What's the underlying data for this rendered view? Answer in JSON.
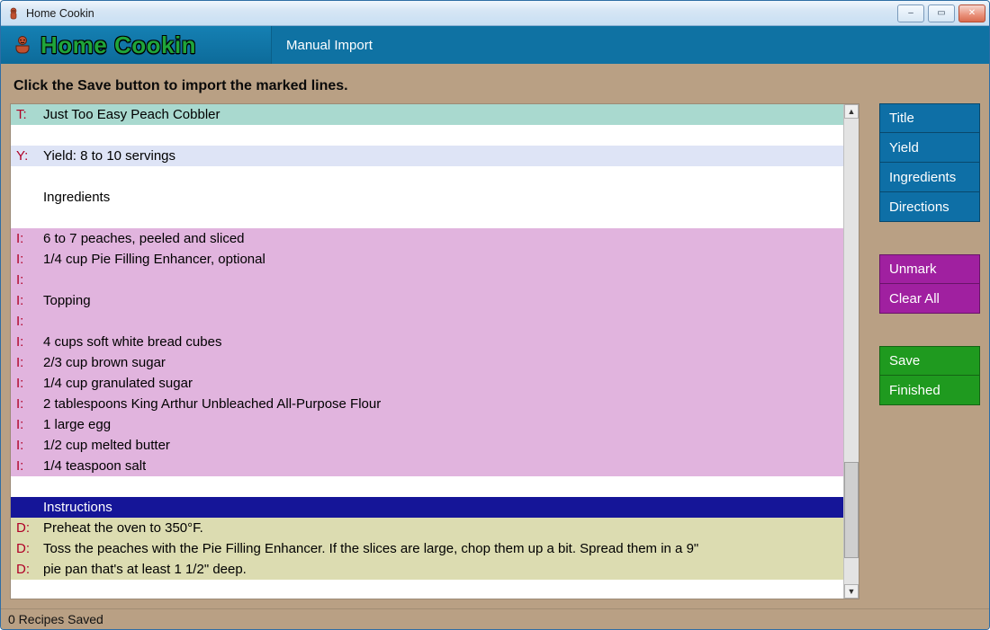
{
  "window": {
    "title": "Home Cookin",
    "controls": {
      "min": "–",
      "max": "▭",
      "close": "✕"
    }
  },
  "appbar": {
    "brand": "Home Cookin",
    "section": "Manual Import"
  },
  "instruction": "Click the Save button to import the marked lines.",
  "lines": [
    {
      "tag": "T:",
      "type": "T",
      "text": "Just Too Easy Peach Cobbler"
    },
    {
      "tag": "",
      "type": "blank",
      "text": ""
    },
    {
      "tag": "Y:",
      "type": "Y",
      "text": "Yield: 8 to 10 servings"
    },
    {
      "tag": "",
      "type": "blank",
      "text": ""
    },
    {
      "tag": "",
      "type": "plain",
      "text": "Ingredients"
    },
    {
      "tag": "",
      "type": "blank",
      "text": ""
    },
    {
      "tag": "I:",
      "type": "I",
      "text": "6 to 7 peaches, peeled and sliced"
    },
    {
      "tag": "I:",
      "type": "I",
      "text": "1/4 cup Pie Filling Enhancer, optional"
    },
    {
      "tag": "I:",
      "type": "I",
      "text": ""
    },
    {
      "tag": "I:",
      "type": "I",
      "text": "Topping"
    },
    {
      "tag": "I:",
      "type": "I",
      "text": ""
    },
    {
      "tag": "I:",
      "type": "I",
      "text": "4 cups soft white bread cubes"
    },
    {
      "tag": "I:",
      "type": "I",
      "text": "2/3 cup brown sugar"
    },
    {
      "tag": "I:",
      "type": "I",
      "text": "1/4 cup granulated sugar"
    },
    {
      "tag": "I:",
      "type": "I",
      "text": "2 tablespoons King Arthur Unbleached All-Purpose Flour"
    },
    {
      "tag": "I:",
      "type": "I",
      "text": "1 large egg"
    },
    {
      "tag": "I:",
      "type": "I",
      "text": "1/2 cup melted butter"
    },
    {
      "tag": "I:",
      "type": "I",
      "text": "1/4 teaspoon salt"
    },
    {
      "tag": "",
      "type": "blank",
      "text": ""
    },
    {
      "tag": "",
      "type": "selected",
      "text": "Instructions"
    },
    {
      "tag": "D:",
      "type": "D",
      "text": "Preheat the oven to 350°F."
    },
    {
      "tag": "D:",
      "type": "D",
      "text": "Toss the peaches with the Pie Filling Enhancer. If the slices are large, chop them up a bit. Spread them in a 9\""
    },
    {
      "tag": "D:",
      "type": "D",
      "text": "pie pan that's at least 1 1/2\" deep."
    }
  ],
  "buttons": {
    "blue": [
      "Title",
      "Yield",
      "Ingredients",
      "Directions"
    ],
    "purple": [
      "Unmark",
      "Clear All"
    ],
    "green": [
      "Save",
      "Finished"
    ]
  },
  "status": "0 Recipes Saved",
  "colors": {
    "app_bg": "#b9a084",
    "appbar_bg": "#0f72a3",
    "brand_green": "#1fa53a",
    "tag_red": "#b00026",
    "title_row": "#a9d9cf",
    "yield_row": "#dee4f6",
    "ingredient_row": "#e1b4de",
    "direction_row": "#dcdcb1",
    "selected_row": "#151598",
    "btn_blue": "#0e6fa6",
    "btn_purple": "#a020a0",
    "btn_green": "#1f9a1f"
  }
}
